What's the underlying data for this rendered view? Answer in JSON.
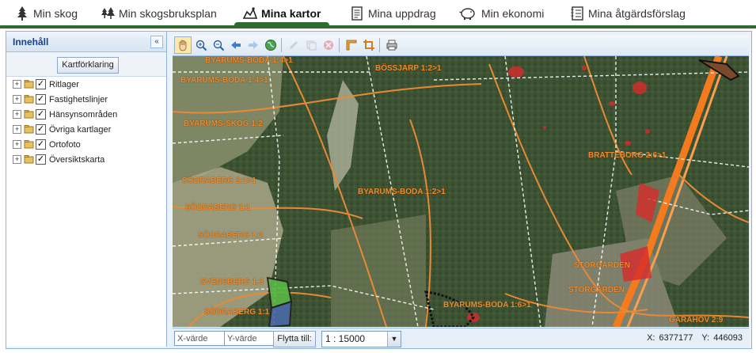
{
  "nav": {
    "items": [
      {
        "label": "Min skog",
        "icon": "tree-icon"
      },
      {
        "label": "Min skogsbruksplan",
        "icon": "forest-icon"
      },
      {
        "label": "Mina kartor",
        "icon": "map-icon",
        "active": true
      },
      {
        "label": "Mina uppdrag",
        "icon": "document-icon"
      },
      {
        "label": "Min ekonomi",
        "icon": "piggy-bank-icon"
      },
      {
        "label": "Mina åtgärdsförslag",
        "icon": "notebook-icon"
      }
    ],
    "accent": "#2e6b2e"
  },
  "sidebar": {
    "title": "Innehåll",
    "collapse_label": "«",
    "legend_button": "Kartförklaring",
    "layers": [
      {
        "label": "Ritlager",
        "checked": true
      },
      {
        "label": "Fastighetslinjer",
        "checked": true
      },
      {
        "label": "Hänsynsområden",
        "checked": true
      },
      {
        "label": "Övriga kartlager",
        "checked": true
      },
      {
        "label": "Ortofoto",
        "checked": true
      },
      {
        "label": "Översiktskarta",
        "checked": true
      }
    ]
  },
  "toolbar": {
    "tools": [
      "pan-hand-icon",
      "zoom-in-icon",
      "zoom-out-icon",
      "back-arrow-icon",
      "forward-arrow-icon",
      "globe-icon",
      "edit-pencil-icon",
      "copy-icon",
      "delete-icon",
      "measure-ruler-icon",
      "crop-icon",
      "print-icon"
    ]
  },
  "map": {
    "labels": [
      "BYARUMS-BODA 1:4>1",
      "BÖSSJARP 1:2>1",
      "BYARUMS-BODA 1:4>1",
      "BYARUMS-SKOG 1:2",
      "BRATTEBORG 2:6>1",
      "SÖDRABERG 2:1>1",
      "BYARUMS-BODA 1:2>1",
      "SÖDRABERG 1:1",
      "SÖDRABERG 1:2",
      "SVENSBERG 1:3",
      "STORGÅRDEN",
      "SÖDRABERG 1:1",
      "STORGÅRDEN",
      "BYARUMS-BODA 1:6>1",
      "GÅRAHOV 2:9"
    ]
  },
  "bottom": {
    "x_placeholder": "X-värde",
    "y_placeholder": "Y-värde",
    "goto_label": "Flytta till:",
    "scale": "1 : 15000",
    "x_label": "X:",
    "x_value": "6377177",
    "y_label": "Y:",
    "y_value": "446093"
  }
}
